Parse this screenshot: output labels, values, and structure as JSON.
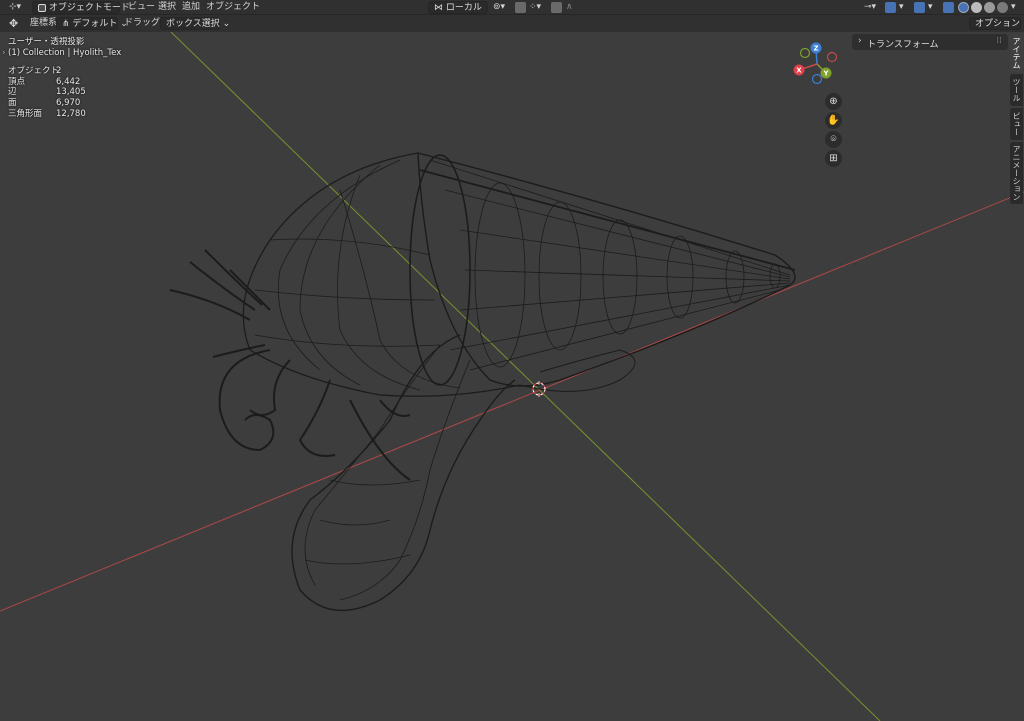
{
  "header": {
    "mode_label": "オブジェクトモード",
    "menu": [
      "ビュー",
      "選択",
      "追加",
      "オブジェクト"
    ],
    "transform_orientation": "ローカル",
    "coord_label": "座標系:",
    "coord_value": "デフォルト",
    "drag_label": "ドラッグ:",
    "drag_value": "ボックス選択",
    "options_label": "オプション"
  },
  "overlay": {
    "view_name": "ユーザー・透視投影",
    "collection": "(1) Collection | Hyolith_Tex",
    "stats": [
      {
        "label": "オブジェクト",
        "value": "2"
      },
      {
        "label": "頂点",
        "value": "6,442"
      },
      {
        "label": "辺",
        "value": "13,405"
      },
      {
        "label": "面",
        "value": "6,970"
      },
      {
        "label": "三角形面",
        "value": "12,780"
      }
    ]
  },
  "gizmo": {
    "x": "X",
    "y": "Y",
    "z": "Z"
  },
  "nav_icons": [
    "zoom-icon",
    "hand-pan-icon",
    "camera-icon",
    "grid-perspective-icon"
  ],
  "sidebar": {
    "panel_title": "トランスフォーム",
    "tabs": [
      "アイテム",
      "ツール",
      "ビュー",
      "アニメーション"
    ]
  },
  "colors": {
    "viewport_bg": "#3d3d3d",
    "header_bg": "#303030",
    "x_axis": "#c44a4a",
    "y_axis": "#7fa12c",
    "z_axis": "#3b7fd6",
    "wire": "#1a1a1a"
  }
}
